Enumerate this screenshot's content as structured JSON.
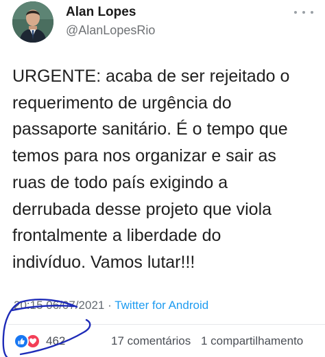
{
  "tweet": {
    "author_name": "Alan Lopes",
    "author_handle": "@AlanLopesRio",
    "more_icon": "more-horizontal-icon",
    "text": "URGENTE: acaba de ser rejeitado o\nrequerimento de urgência do\npassaporte sanitário. É o tempo que\ntemos para nos organizar e sair as\nruas de todo país exigindo a\nderrubada desse projeto que viola\nfrontalmente a liberdade do\nindivíduo. Vamos lutar!!!",
    "time": "20:15",
    "date": "06/07/2021",
    "separator": " · ",
    "source": "Twitter for Android"
  },
  "facebook_bar": {
    "reaction_icons": [
      "like-icon",
      "love-icon"
    ],
    "reactions_count": "462",
    "comments": "17 comentários",
    "shares": "1 compartilhamento"
  },
  "colors": {
    "text": "#202020",
    "secondary": "#646b72",
    "link": "#1d9bf0",
    "like": "#1877f2",
    "love": "#f33e58",
    "annotation": "#1e2bb8"
  }
}
